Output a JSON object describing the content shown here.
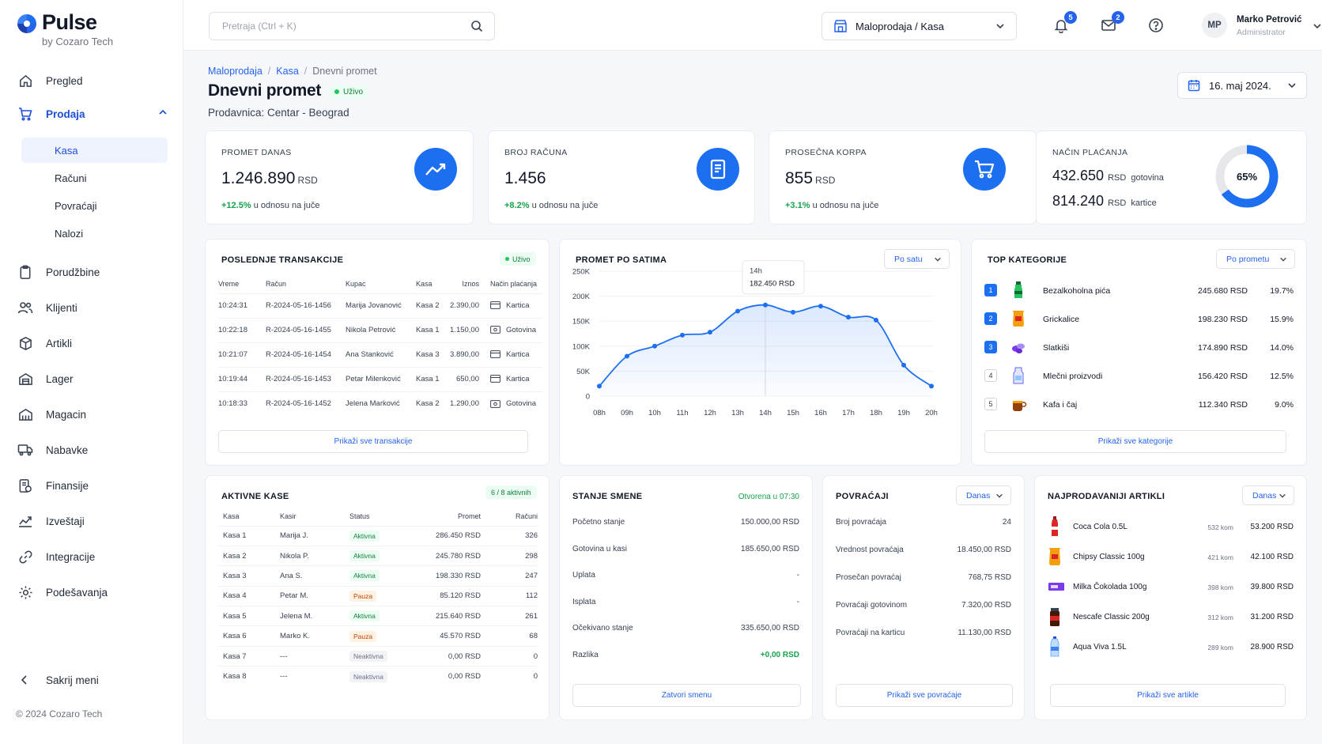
{
  "brand": {
    "name": "Pulse",
    "sub": "by Cozaro Tech"
  },
  "nav": {
    "items": [
      {
        "label": "Pregled"
      },
      {
        "label": "Prodaja"
      },
      {
        "label": "Porudžbine"
      },
      {
        "label": "Klijenti"
      },
      {
        "label": "Artikli"
      },
      {
        "label": "Lager"
      },
      {
        "label": "Magacin"
      },
      {
        "label": "Nabavke"
      },
      {
        "label": "Finansije"
      },
      {
        "label": "Izveštaji"
      },
      {
        "label": "Integracije"
      },
      {
        "label": "Podešavanja"
      }
    ],
    "sub_items": [
      {
        "label": "Kasa"
      },
      {
        "label": "Računi"
      },
      {
        "label": "Povraćaji"
      },
      {
        "label": "Nalozi"
      }
    ],
    "collapse_label": "Sakrij meni",
    "copyright": "© 2024 Cozaro Tech"
  },
  "topbar": {
    "search_placeholder": "Pretraja (Ctrl + K)",
    "store": "Maloprodaja / Kasa",
    "notifications_count": "5",
    "messages_count": "2",
    "user": {
      "initials": "MP",
      "name": "Marko Petrović",
      "role": "Administrator"
    }
  },
  "page": {
    "breadcrumb": [
      "Maloprodaja",
      "Kasa",
      "Dnevni promet"
    ],
    "title": "Dnevni promet",
    "live": "Uživo",
    "store_line": "Prodavnica: Centar - Beograd",
    "date": "16. maj 2024."
  },
  "kpis": [
    {
      "label": "PROMET DANAS",
      "value": "1.246.890",
      "unit": "RSD",
      "delta": "+12.5%",
      "delta_text": "u odnosu na juče"
    },
    {
      "label": "BROJ RAČUNA",
      "value": "1.456",
      "unit": "",
      "delta": "+8.2%",
      "delta_text": "u odnosu na juče"
    },
    {
      "label": "PROSEČNA KORPA",
      "value": "855",
      "unit": "RSD",
      "delta": "+3.1%",
      "delta_text": "u odnosu na juče"
    }
  ],
  "payment": {
    "label": "NAČIN PLAĆANJA",
    "cash_value": "432.650",
    "cash_unit": "RSD",
    "cash_label": "gotovina",
    "card_value": "814.240",
    "card_unit": "RSD",
    "card_label": "kartice",
    "percent": "65%",
    "fraction": 0.65
  },
  "transactions": {
    "title": "POSLEDNJE TRANSAKCIJE",
    "live": "Uživo",
    "headers": [
      "Vreme",
      "Račun",
      "Kupac",
      "Kasa",
      "Iznos",
      "Način plaćanja"
    ],
    "rows": [
      [
        "10:24:31",
        "R-2024-05-16-1456",
        "Marija Jovanović",
        "Kasa 2",
        "2.390,00",
        "Kartica"
      ],
      [
        "10:22:18",
        "R-2024-05-16-1455",
        "Nikola Petrović",
        "Kasa 1",
        "1.150,00",
        "Gotovina"
      ],
      [
        "10:21:07",
        "R-2024-05-16-1454",
        "Ana Stanković",
        "Kasa 3",
        "3.890,00",
        "Kartica"
      ],
      [
        "10:19:44",
        "R-2024-05-16-1453",
        "Petar Milenković",
        "Kasa 1",
        "650,00",
        "Kartica"
      ],
      [
        "10:18:33",
        "R-2024-05-16-1452",
        "Jelena Marković",
        "Kasa 2",
        "1.290,00",
        "Gotovina"
      ]
    ],
    "button": "Prikaži sve transakcije"
  },
  "hourly": {
    "title": "PROMET PO SATIMA",
    "select": "Po satu",
    "tooltip": {
      "hour": "14h",
      "value": "182.450 RSD"
    }
  },
  "chart_data": {
    "type": "area",
    "title": "PROMET PO SATIMA",
    "categories": [
      "08h",
      "09h",
      "10h",
      "11h",
      "12h",
      "13h",
      "14h",
      "15h",
      "16h",
      "17h",
      "18h",
      "19h",
      "20h"
    ],
    "x": [
      "08h",
      "08h30",
      "09h",
      "09h30",
      "10h",
      "10h30",
      "11h",
      "11h30",
      "12h",
      "12h30",
      "13h",
      "13h30",
      "14h",
      "14h30",
      "15h",
      "15h30",
      "16h",
      "16h30",
      "17h",
      "17h30",
      "18h",
      "18h30",
      "19h",
      "19h30",
      "20h"
    ],
    "values": [
      20000,
      null,
      80000,
      null,
      100000,
      null,
      122000,
      null,
      128000,
      null,
      170000,
      null,
      182450,
      null,
      168000,
      null,
      180000,
      null,
      158000,
      null,
      152000,
      null,
      62000,
      null,
      20000
    ],
    "y_ticks": [
      "0",
      "50K",
      "100K",
      "150K",
      "200K",
      "250K"
    ],
    "ylim": [
      0,
      250000
    ],
    "grid": true,
    "color": "#1d6ff2"
  },
  "categories_panel": {
    "title": "TOP KATEGORIJE",
    "select": "Po prometu",
    "rows": [
      {
        "rank": "1",
        "name": "Bezalkoholna pića",
        "value": "245.680 RSD",
        "pct": "19.7%"
      },
      {
        "rank": "2",
        "name": "Grickalice",
        "value": "198.230 RSD",
        "pct": "15.9%"
      },
      {
        "rank": "3",
        "name": "Slatkiši",
        "value": "174.890 RSD",
        "pct": "14.0%"
      },
      {
        "rank": "4",
        "name": "Mlečni proizvodi",
        "value": "156.420 RSD",
        "pct": "12.5%"
      },
      {
        "rank": "5",
        "name": "Kafa i čaj",
        "value": "112.340 RSD",
        "pct": "9.0%"
      }
    ],
    "button": "Prikaži sve kategorije"
  },
  "registers": {
    "title": "AKTIVNE KASE",
    "badge": "6 / 8 aktivnih",
    "headers": [
      "Kasa",
      "Kasir",
      "Status",
      "Promet",
      "Računi"
    ],
    "rows": [
      [
        "Kasa 1",
        "Marija J.",
        "Aktivna",
        "286.450 RSD",
        "326"
      ],
      [
        "Kasa 2",
        "Nikola P.",
        "Aktivna",
        "245.780 RSD",
        "298"
      ],
      [
        "Kasa 3",
        "Ana S.",
        "Aktivna",
        "198.330 RSD",
        "247"
      ],
      [
        "Kasa 4",
        "Petar M.",
        "Pauza",
        "85.120 RSD",
        "112"
      ],
      [
        "Kasa 5",
        "Jelena M.",
        "Aktivna",
        "215.640 RSD",
        "261"
      ],
      [
        "Kasa 6",
        "Marko K.",
        "Pauza",
        "45.570 RSD",
        "68"
      ],
      [
        "Kasa 7",
        "---",
        "Neaktivna",
        "0,00 RSD",
        "0"
      ],
      [
        "Kasa 8",
        "---",
        "Neaktivna",
        "0,00 RSD",
        "0"
      ]
    ]
  },
  "shift": {
    "title": "STANJE SMENE",
    "opened": "Otvorena u 07:30",
    "rows": [
      [
        "Početno stanje",
        "150.000,00 RSD"
      ],
      [
        "Gotovina u kasi",
        "185.650,00 RSD"
      ],
      [
        "Uplata",
        "-"
      ],
      [
        "Isplata",
        "-"
      ],
      [
        "Očekivano stanje",
        "335.650,00 RSD"
      ],
      [
        "Razlika",
        "+0,00 RSD"
      ]
    ],
    "button": "Zatvori smenu"
  },
  "returns": {
    "title": "POVRAĆAJI",
    "select": "Danas",
    "rows": [
      [
        "Broj povraćaja",
        "24"
      ],
      [
        "Vrednost povraćaja",
        "18.450,00 RSD"
      ],
      [
        "Prosečan povraćaj",
        "768,75 RSD"
      ],
      [
        "Povraćaji gotovinom",
        "7.320,00 RSD"
      ],
      [
        "Povraćaji na karticu",
        "11.130,00 RSD"
      ]
    ],
    "button": "Prikaži sve povraćaje"
  },
  "top_products": {
    "title": "NAJPRODAVANIJI ARTIKLI",
    "select": "Danas",
    "rows": [
      {
        "name": "Coca Cola 0.5L",
        "qty": "532 kom",
        "value": "53.200 RSD"
      },
      {
        "name": "Chipsy Classic 100g",
        "qty": "421 kom",
        "value": "42.100 RSD"
      },
      {
        "name": "Milka Čokolada 100g",
        "qty": "398 kom",
        "value": "39.800 RSD"
      },
      {
        "name": "Nescafe Classic 200g",
        "qty": "312 kom",
        "value": "31.200 RSD"
      },
      {
        "name": "Aqua Viva 1.5L",
        "qty": "289 kom",
        "value": "28.900 RSD"
      }
    ],
    "button": "Prikaži sve artikle"
  }
}
